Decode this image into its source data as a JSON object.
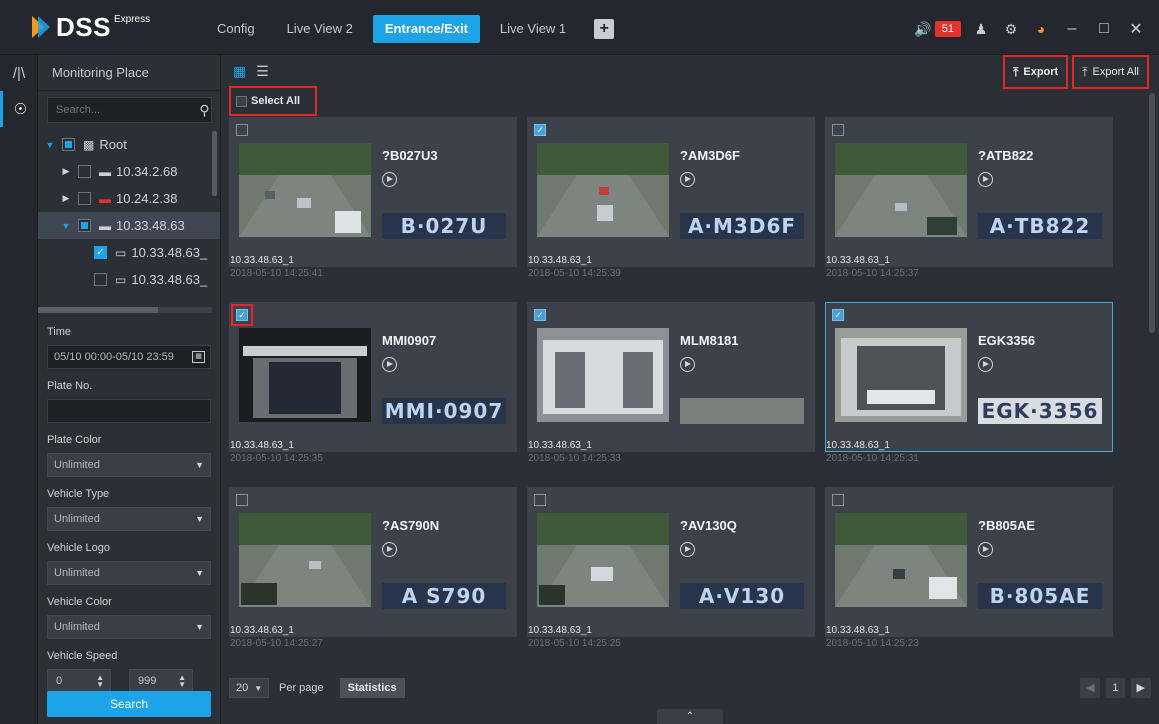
{
  "app": {
    "logo_text": "DSS",
    "logo_sup": "Express"
  },
  "tabs": [
    {
      "label": "Config",
      "active": false
    },
    {
      "label": "Live View 2",
      "active": false
    },
    {
      "label": "Entrance/Exit",
      "active": true
    },
    {
      "label": "Live View 1",
      "active": false
    }
  ],
  "topbar": {
    "alarm_count": "51",
    "icons": [
      "speaker-icon",
      "user-icon",
      "gear-icon",
      "gauge-icon"
    ]
  },
  "left_panel": {
    "title": "Monitoring Place",
    "search_placeholder": "Search...",
    "tree": [
      {
        "label": "Root",
        "level": 0,
        "expanded": true,
        "check": "partial",
        "icon": "root-icon"
      },
      {
        "label": "10.34.2.68",
        "level": 1,
        "expanded": false,
        "check": "none",
        "icon": "nvr-icon"
      },
      {
        "label": "10.24.2.38",
        "level": 1,
        "expanded": false,
        "check": "none",
        "icon": "nvr-offline-icon"
      },
      {
        "label": "10.33.48.63",
        "level": 1,
        "expanded": true,
        "check": "partial",
        "icon": "nvr-icon",
        "selected": true
      },
      {
        "label": "10.33.48.63_",
        "level": 2,
        "check": "checked",
        "icon": "camera-icon"
      },
      {
        "label": "10.33.48.63_",
        "level": 2,
        "check": "none",
        "icon": "camera-icon"
      }
    ],
    "filters": {
      "time_label": "Time",
      "time_value": "05/10 00:00-05/10 23:59",
      "plate_no_label": "Plate No.",
      "plate_no_value": "",
      "plate_color_label": "Plate Color",
      "plate_color_value": "Unlimited",
      "vehicle_type_label": "Vehicle Type",
      "vehicle_type_value": "Unlimited",
      "vehicle_logo_label": "Vehicle Logo",
      "vehicle_logo_value": "Unlimited",
      "vehicle_color_label": "Vehicle Color",
      "vehicle_color_value": "Unlimited",
      "vehicle_speed_label": "Vehicle Speed",
      "speed_min": "0",
      "speed_max": "999"
    },
    "search_button": "Search"
  },
  "main": {
    "export_label": "Export",
    "export_all_label": "Export All",
    "select_all_label": "Select All",
    "records": [
      {
        "plate": "?B027U3",
        "plate_img_text": "B·027U",
        "device": "10.33.48.63_1",
        "time": "2018-05-10 14:25:41",
        "checked": false
      },
      {
        "plate": "?AM3D6F",
        "plate_img_text": "A·M3D6F",
        "device": "10.33.48.63_1",
        "time": "2018-05-10 14:25:39",
        "checked": true
      },
      {
        "plate": "?ATB822",
        "plate_img_text": "A·TB822",
        "device": "10.33.48.63_1",
        "time": "2018-05-10 14:25:37",
        "checked": false
      },
      {
        "plate": "MMI0907",
        "plate_img_text": "MMI·0907",
        "device": "10.33.48.63_1",
        "time": "2018-05-10 14:25:35",
        "checked": true
      },
      {
        "plate": "MLM8181",
        "plate_img_text": "",
        "device": "10.33.48.63_1",
        "time": "2018-05-10 14:25:33",
        "checked": true
      },
      {
        "plate": "EGK3356",
        "plate_img_text": "EGK·3356",
        "device": "10.33.48.63_1",
        "time": "2018-05-10 14:25:31",
        "checked": true
      },
      {
        "plate": "?AS790N",
        "plate_img_text": "A S790",
        "device": "10.33.48.63_1",
        "time": "2018-05-10 14:25:27",
        "checked": false
      },
      {
        "plate": "?AV130Q",
        "plate_img_text": "A·V130",
        "device": "10.33.48.63_1",
        "time": "2018-05-10 14:25:25",
        "checked": false
      },
      {
        "plate": "?B805AE",
        "plate_img_text": "B·805AE",
        "device": "10.33.48.63_1",
        "time": "2018-05-10 14:25:23",
        "checked": false
      }
    ],
    "per_page_value": "20",
    "per_page_label": "Per page",
    "statistics_label": "Statistics",
    "current_page": "1"
  },
  "colors": {
    "accent": "#1da4e8",
    "highlight_box": "#e5252a",
    "alarm": "#e5322d"
  }
}
